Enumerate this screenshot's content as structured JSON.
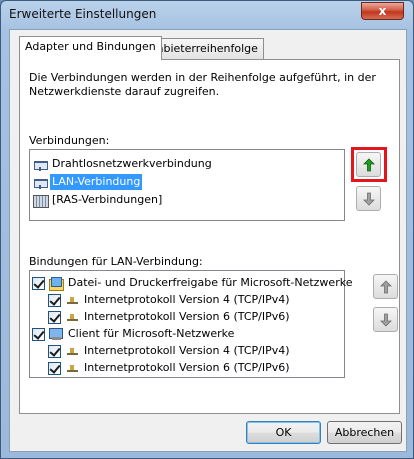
{
  "window": {
    "title": "Erweiterte Einstellungen",
    "close_label": "x"
  },
  "tabs": [
    {
      "label": "Adapter und Bindungen",
      "active": true
    },
    {
      "label": "Anbieterreihenfolge",
      "active": false
    }
  ],
  "description": "Die Verbindungen werden in der Reihenfolge aufgeführt, in der Netzwerkdienste darauf zugreifen.",
  "connections": {
    "label": "Verbindungen:",
    "items": [
      {
        "label": "Drahtlosnetzwerkverbindung",
        "icon": "network-adapter-icon",
        "selected": false
      },
      {
        "label": "LAN-Verbindung",
        "icon": "network-adapter-icon",
        "selected": true
      },
      {
        "label": "[RAS-Verbindungen]",
        "icon": "ras-connections-icon",
        "selected": false
      }
    ]
  },
  "bindings": {
    "label": "Bindungen für LAN-Verbindung:",
    "items": [
      {
        "label": "Datei- und Druckerfreigabe für Microsoft-Netzwerke",
        "checked": true,
        "level": 0,
        "icon": "file-printer-sharing-icon"
      },
      {
        "label": "Internetprotokoll Version 4 (TCP/IPv4)",
        "checked": true,
        "level": 1,
        "icon": "protocol-icon"
      },
      {
        "label": "Internetprotokoll Version 6 (TCP/IPv6)",
        "checked": true,
        "level": 1,
        "icon": "protocol-icon"
      },
      {
        "label": "Client für Microsoft-Netzwerke",
        "checked": true,
        "level": 0,
        "icon": "network-client-icon"
      },
      {
        "label": "Internetprotokoll Version 4 (TCP/IPv4)",
        "checked": true,
        "level": 1,
        "icon": "protocol-icon"
      },
      {
        "label": "Internetprotokoll Version 6 (TCP/IPv6)",
        "checked": true,
        "level": 1,
        "icon": "protocol-icon"
      }
    ]
  },
  "buttons": {
    "ok": "OK",
    "cancel": "Abbrechen"
  },
  "colors": {
    "highlight": "#e3161d",
    "arrow_active": "#1f9c1f",
    "selection": "#3399ff"
  }
}
